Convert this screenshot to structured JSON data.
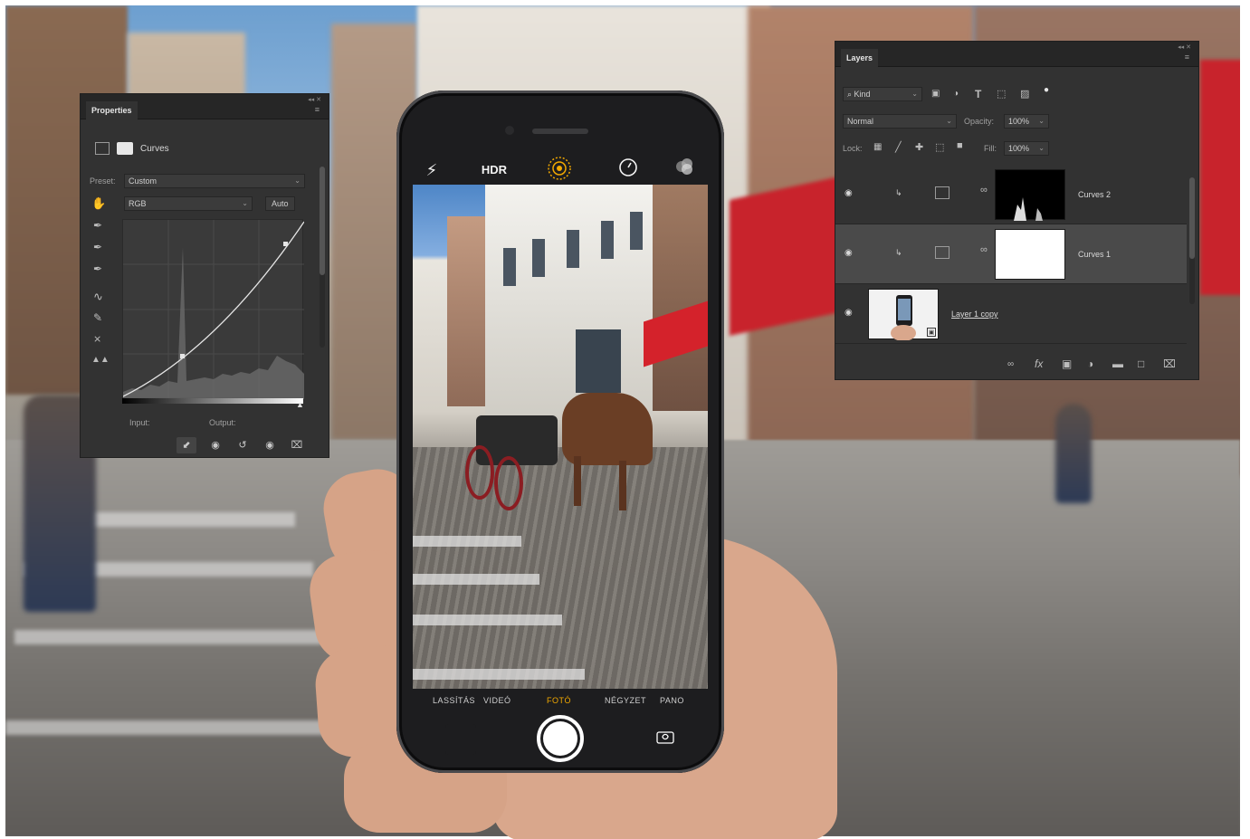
{
  "properties_panel": {
    "tab_label": "Properties",
    "adjustment_name": "Curves",
    "preset_label": "Preset:",
    "preset_value": "Custom",
    "channel_value": "RGB",
    "auto_label": "Auto",
    "input_label": "Input:",
    "output_label": "Output:"
  },
  "layers_panel": {
    "tab_label": "Layers",
    "filter_kind": "Kind",
    "blend_mode": "Normal",
    "opacity_label": "Opacity:",
    "opacity_value": "100%",
    "lock_label": "Lock:",
    "fill_label": "Fill:",
    "fill_value": "100%",
    "layers": [
      {
        "name": "Curves 2",
        "selected": false
      },
      {
        "name": "Curves 1",
        "selected": true
      },
      {
        "name": "Layer 1 copy",
        "selected": false
      }
    ]
  },
  "camera_app": {
    "hdr_label": "HDR",
    "modes": [
      "LASSÍTÁS",
      "VIDEÓ",
      "FOTÓ",
      "NÉGYZET",
      "PANO"
    ],
    "active_mode": "FOTÓ",
    "accent_color": "#f2a900"
  },
  "icons": {
    "flash": "flash-icon",
    "hdr": "hdr-icon",
    "live_photo": "live-photo-icon",
    "timer": "timer-icon",
    "filters": "filters-icon",
    "shutter": "shutter-button",
    "flip": "flip-camera-icon",
    "visibility": "eye-icon"
  }
}
